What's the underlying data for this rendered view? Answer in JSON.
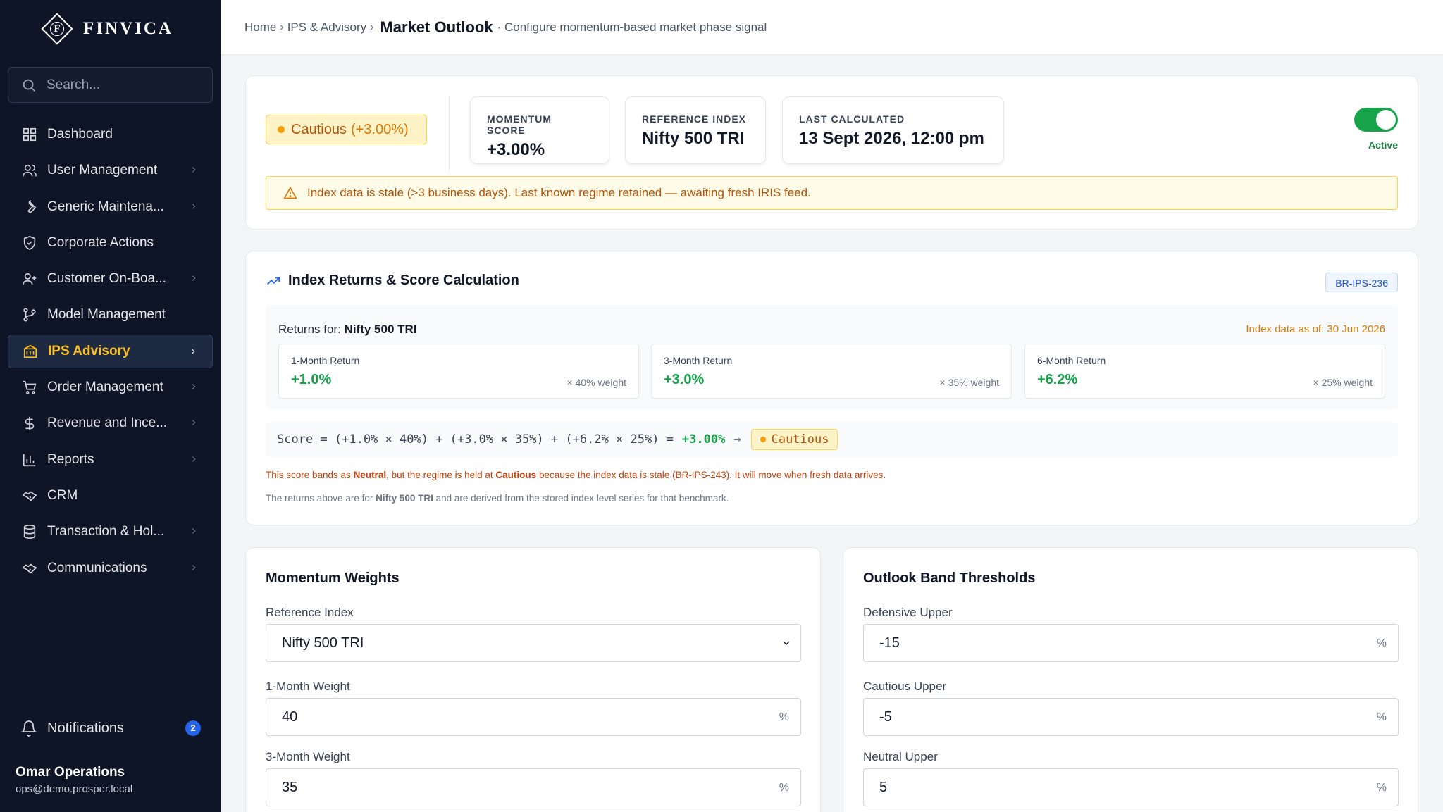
{
  "brand": {
    "name": "FINVICA",
    "mark_letter": "F"
  },
  "search": {
    "placeholder": "Search..."
  },
  "sidebar": {
    "items": [
      {
        "label": "Dashboard",
        "icon": "grid-icon",
        "chevron": false
      },
      {
        "label": "User Management",
        "icon": "users-icon",
        "chevron": true
      },
      {
        "label": "Generic Maintena...",
        "icon": "wrench-icon",
        "chevron": true
      },
      {
        "label": "Corporate Actions",
        "icon": "shield-icon",
        "chevron": false
      },
      {
        "label": "Customer On-Boa...",
        "icon": "user-plus-icon",
        "chevron": true
      },
      {
        "label": "Model Management",
        "icon": "git-branch-icon",
        "chevron": false
      },
      {
        "label": "IPS Advisory",
        "icon": "building-icon",
        "chevron": true,
        "active": true
      },
      {
        "label": "Order Management",
        "icon": "cart-icon",
        "chevron": true
      },
      {
        "label": "Revenue and Ince...",
        "icon": "dollar-icon",
        "chevron": true
      },
      {
        "label": "Reports",
        "icon": "bar-chart-icon",
        "chevron": true
      },
      {
        "label": "CRM",
        "icon": "handshake-icon",
        "chevron": false
      },
      {
        "label": "Transaction & Hol...",
        "icon": "database-icon",
        "chevron": true
      },
      {
        "label": "Communications",
        "icon": "handshake-icon",
        "chevron": true
      }
    ],
    "notifications": {
      "label": "Notifications",
      "count": "2"
    },
    "user": {
      "name": "Omar Operations",
      "email": "ops@demo.prosper.local"
    }
  },
  "header": {
    "breadcrumb": [
      "Home",
      "IPS & Advisory"
    ],
    "title": "Market Outlook",
    "subtitle": "· Configure momentum-based market phase signal"
  },
  "status": {
    "regime": "Cautious",
    "regime_pct": "(+3.00%)",
    "stats": [
      {
        "label": "MOMENTUM SCORE",
        "value": "+3.00%"
      },
      {
        "label": "REFERENCE INDEX",
        "value": "Nifty 500 TRI"
      },
      {
        "label": "LAST CALCULATED",
        "value": "13 Sept 2026, 12:00 pm"
      }
    ],
    "toggle_label": "Active",
    "alert": "Index data is stale (>3 business days). Last known regime retained — awaiting fresh IRIS feed."
  },
  "returns": {
    "title": "Index Returns & Score Calculation",
    "code": "BR-IPS-236",
    "returns_for_label": "Returns for:",
    "returns_for_value": "Nifty 500 TRI",
    "as_of": "Index data as of: 30 Jun 2026",
    "items": [
      {
        "label": "1-Month Return",
        "value": "+1.0%",
        "weight": "× 40% weight"
      },
      {
        "label": "3-Month Return",
        "value": "+3.0%",
        "weight": "× 35% weight"
      },
      {
        "label": "6-Month Return",
        "value": "+6.2%",
        "weight": "× 25% weight"
      }
    ],
    "formula": "Score = (+1.0% × 40%) + (+3.0% × 35%) + (+6.2% × 25%) =",
    "formula_result": "+3.00%",
    "formula_arrow": "→",
    "formula_regime": "Cautious",
    "note_a": "This score bands as ",
    "note_b": "Neutral",
    "note_c": ", but the regime is held at ",
    "note_d": "Cautious",
    "note_e": " because the index data is stale (BR-IPS-243). It will move when fresh data arrives.",
    "note2_a": "The returns above are for ",
    "note2_b": "Nifty 500 TRI",
    "note2_c": " and are derived from the stored index level series for that benchmark."
  },
  "weights": {
    "title": "Momentum Weights",
    "reference_label": "Reference Index",
    "reference_value": "Nifty 500 TRI",
    "w1_label": "1-Month Weight",
    "w1_value": "40",
    "w3_label": "3-Month Weight",
    "w3_value": "35",
    "unit": "%"
  },
  "bands": {
    "title": "Outlook Band Thresholds",
    "def_label": "Defensive Upper",
    "def_value": "-15",
    "cau_label": "Cautious Upper",
    "cau_value": "-5",
    "neu_label": "Neutral Upper",
    "neu_value": "5",
    "unit": "%"
  }
}
